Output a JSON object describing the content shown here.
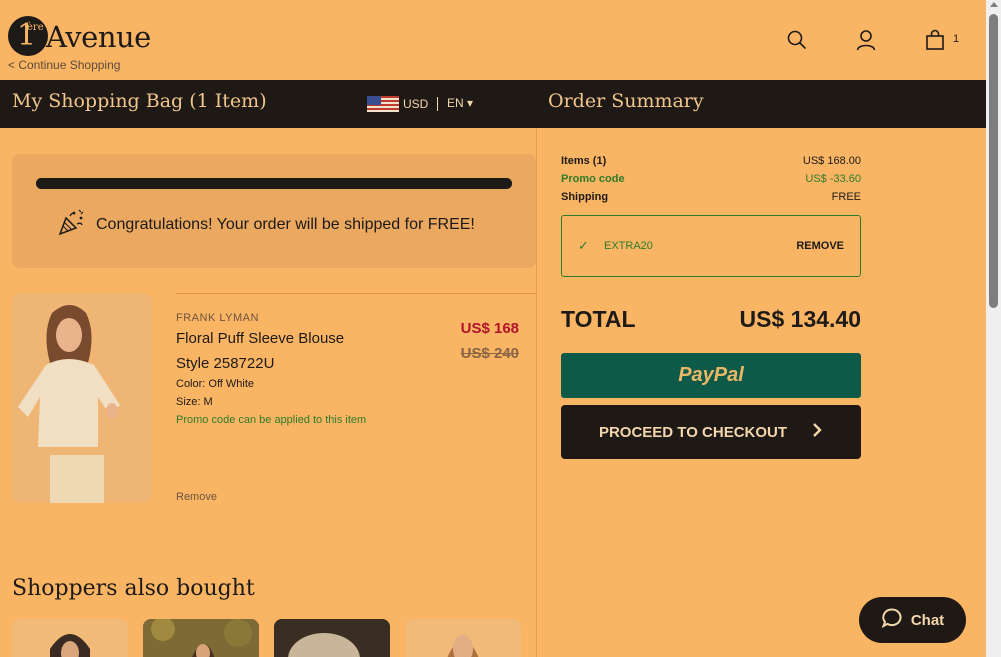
{
  "header": {
    "logo_sup": "ère",
    "logo_one": "1",
    "logo_word": "Avenue",
    "continue_link": "< Continue Shopping",
    "cart_count": "1"
  },
  "bar": {
    "bag_title": "My Shopping Bag (1 Item)",
    "currency": "USD",
    "language": "EN",
    "summary_title": "Order Summary"
  },
  "free_shipping": {
    "message": "Congratulations! Your order will be shipped for FREE!",
    "progress": 1.0
  },
  "product": {
    "brand": "FRANK LYMAN",
    "name": "Floral Puff Sleeve Blouse",
    "style": "Style 258722U",
    "color": "Color: Off White",
    "size": "Size: M",
    "promo_note": "Promo code can be applied to this item",
    "price_now": "US$ 168",
    "price_was": "US$ 240",
    "remove": "Remove"
  },
  "also_bought": {
    "title": "Shoppers also bought"
  },
  "summary": {
    "items_label": "Items (1)",
    "items_value": "US$ 168.00",
    "promo_label": "Promo code",
    "promo_value": "US$ -33.60",
    "shipping_label": "Shipping",
    "shipping_value": "FREE",
    "promo_code": "EXTRA20",
    "promo_remove": "REMOVE",
    "total_label": "TOTAL",
    "total_value": "US$ 134.40",
    "paypal": "PayPal",
    "checkout": "PROCEED TO CHECKOUT"
  },
  "chat": {
    "label": "Chat"
  },
  "colors": {
    "background": "#f9b563",
    "dark": "#1f1915",
    "promo_green": "#2f7a2a",
    "sale_red": "#b3122c",
    "paypal_green": "#0e5a48"
  }
}
